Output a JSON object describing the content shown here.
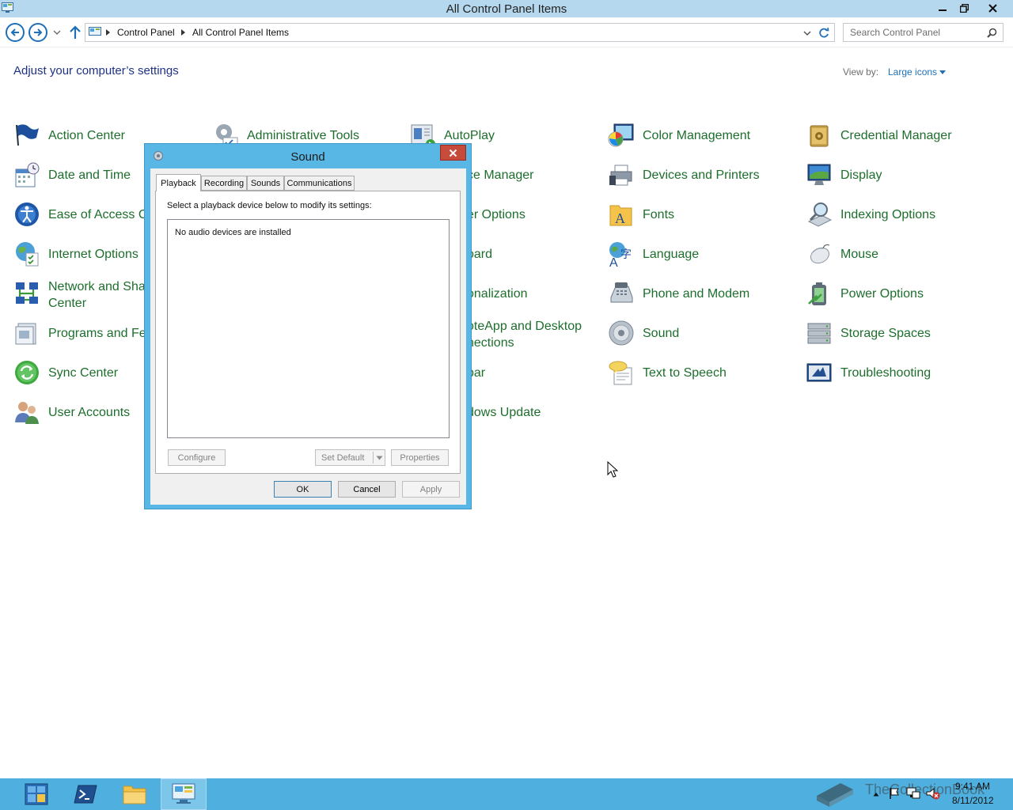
{
  "window": {
    "title": "All Control Panel Items",
    "minimize": "‒",
    "restore": "❐",
    "close": "✕"
  },
  "address": {
    "crumbs": [
      "Control Panel",
      "All Control Panel Items"
    ],
    "search_placeholder": "Search Control Panel"
  },
  "header": {
    "title": "Adjust your computer’s settings",
    "view_by_label": "View by:",
    "view_by_value": "Large icons"
  },
  "items": [
    {
      "label": "Action Center",
      "icon": "flag-icon"
    },
    {
      "label": "Administrative Tools",
      "icon": "admin-tools-icon"
    },
    {
      "label": "AutoPlay",
      "icon": "autoplay-icon"
    },
    {
      "label": "Color Management",
      "icon": "color-management-icon"
    },
    {
      "label": "Credential Manager",
      "icon": "credential-manager-icon"
    },
    {
      "label": "Date and Time",
      "icon": "calendar-clock-icon"
    },
    {
      "label": "ce Manager",
      "icon": "device-manager-icon"
    },
    {
      "label": "Devices and Printers",
      "icon": "printer-icon"
    },
    {
      "label": "Display",
      "icon": "monitor-icon"
    },
    {
      "label": "Ease of Access Ce",
      "icon": "ease-of-access-icon"
    },
    {
      "label": "er Options",
      "icon": "folder-options-icon"
    },
    {
      "label": "Fonts",
      "icon": "fonts-icon"
    },
    {
      "label": "Indexing Options",
      "icon": "indexing-icon"
    },
    {
      "label": "Internet Options",
      "icon": "internet-options-icon"
    },
    {
      "label": "oard",
      "icon": "keyboard-icon"
    },
    {
      "label": "Language",
      "icon": "language-icon"
    },
    {
      "label": "Mouse",
      "icon": "mouse-icon"
    },
    {
      "label": "Network and Sha Center",
      "icon": "network-icon"
    },
    {
      "label": "onalization",
      "icon": "personalization-icon"
    },
    {
      "label": "Phone and Modem",
      "icon": "phone-icon"
    },
    {
      "label": "Power Options",
      "icon": "power-icon"
    },
    {
      "label": "Programs and Fea",
      "icon": "programs-icon"
    },
    {
      "label": "oteApp and Desktop nections",
      "icon": "remoteapp-icon"
    },
    {
      "label": "Sound",
      "icon": "speaker-icon"
    },
    {
      "label": "Storage Spaces",
      "icon": "storage-icon"
    },
    {
      "label": "Sync Center",
      "icon": "sync-icon"
    },
    {
      "label": "bar",
      "icon": "taskbar-icon"
    },
    {
      "label": "Text to Speech",
      "icon": "speech-icon"
    },
    {
      "label": "Troubleshooting",
      "icon": "troubleshooting-icon"
    },
    {
      "label": "User Accounts",
      "icon": "users-icon"
    },
    {
      "label": "dows Update",
      "icon": "windows-update-icon"
    }
  ],
  "dialog": {
    "title": "Sound",
    "close": "✕",
    "tabs": [
      "Playback",
      "Recording",
      "Sounds",
      "Communications"
    ],
    "instructions": "Select a playback device below to modify its settings:",
    "empty_message": "No audio devices are installed",
    "configure": "Configure",
    "set_default": "Set Default",
    "properties": "Properties",
    "ok": "OK",
    "cancel": "Cancel",
    "apply": "Apply"
  },
  "taskbar": {
    "time": "9:41 AM",
    "date": "8/11/2012",
    "watermark": "TheCollectionBook"
  }
}
